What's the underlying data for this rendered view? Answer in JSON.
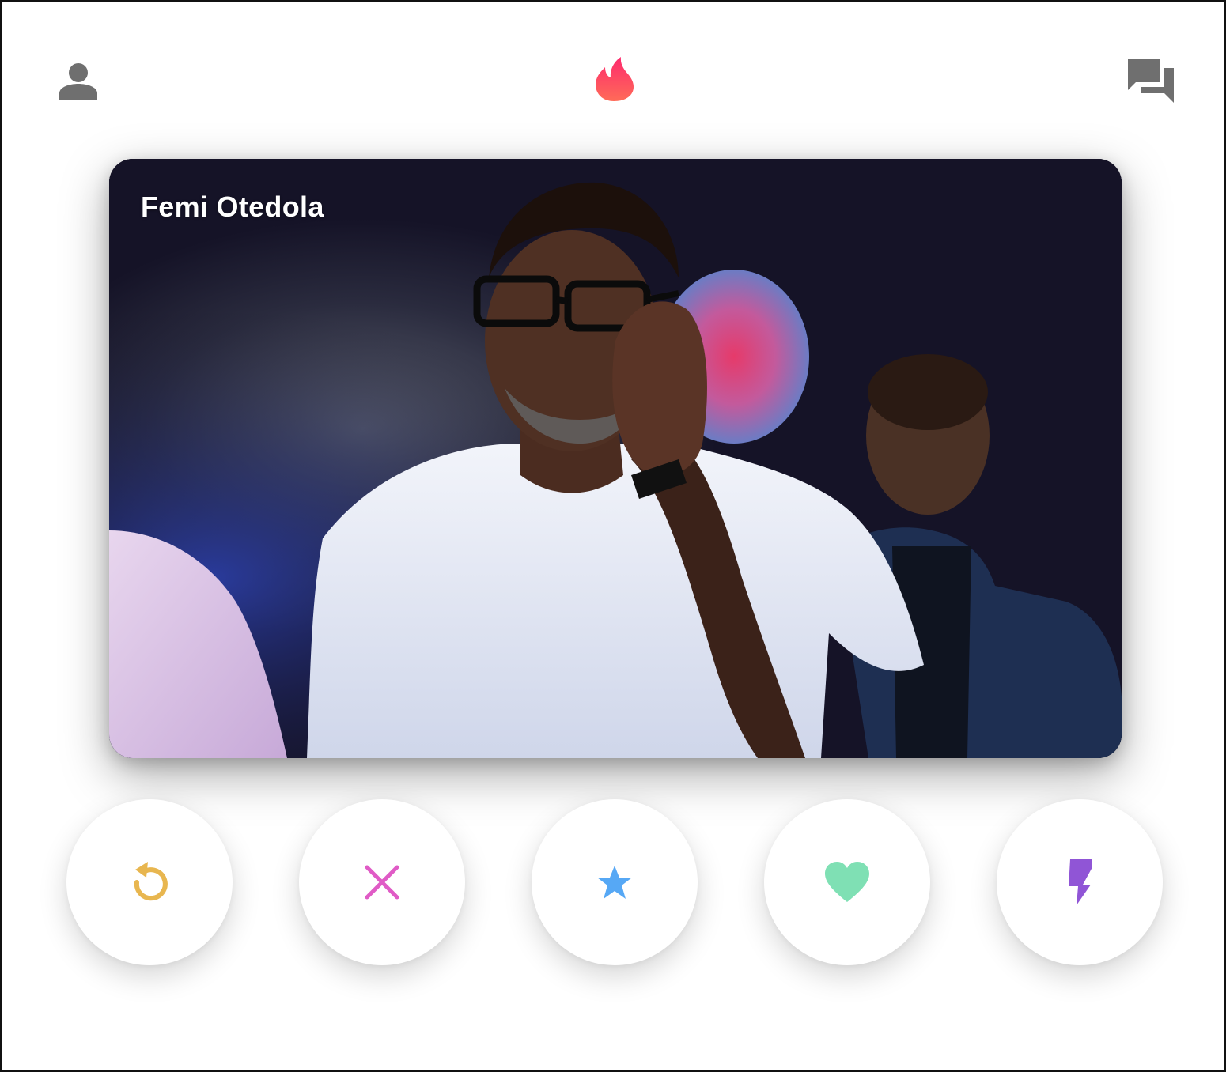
{
  "header": {
    "profile_icon": "person-icon",
    "logo_icon": "flame-icon",
    "messages_icon": "chat-bubbles-icon"
  },
  "card": {
    "name": "Femi Otedola"
  },
  "actions": [
    {
      "id": "rewind",
      "icon": "rewind-icon",
      "color": "#e8b64f"
    },
    {
      "id": "nope",
      "icon": "close-icon",
      "color": "#e05bc6"
    },
    {
      "id": "super_like",
      "icon": "star-icon",
      "color": "#56a8f5"
    },
    {
      "id": "like",
      "icon": "heart-icon",
      "color": "#7fe0b4"
    },
    {
      "id": "boost",
      "icon": "lightning-icon",
      "color": "#9055d6"
    }
  ],
  "colors": {
    "icon_gray": "#6f6f6f",
    "brand_gradient_start": "#fd267d",
    "brand_gradient_end": "#ff7854"
  }
}
